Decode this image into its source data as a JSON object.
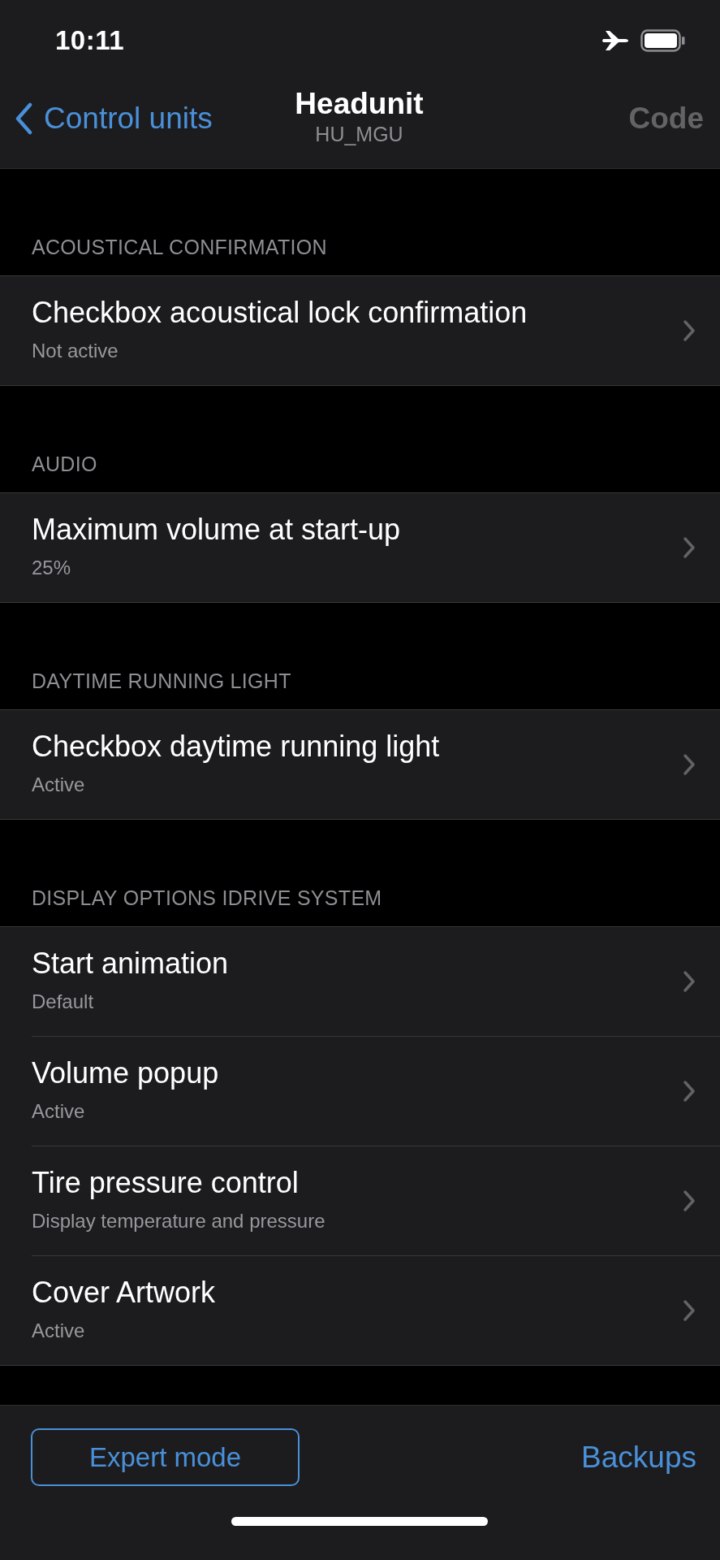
{
  "status_bar": {
    "time": "10:11"
  },
  "nav": {
    "back_label": "Control units",
    "title": "Headunit",
    "subtitle": "HU_MGU",
    "right_button": {
      "label": "Code",
      "disabled": true
    }
  },
  "sections": [
    {
      "header": "ACOUSTICAL CONFIRMATION",
      "items": [
        {
          "title": "Checkbox acoustical lock confirmation",
          "value": "Not active"
        }
      ]
    },
    {
      "header": "AUDIO",
      "items": [
        {
          "title": "Maximum volume at start-up",
          "value": "25%"
        }
      ]
    },
    {
      "header": "DAYTIME RUNNING LIGHT",
      "items": [
        {
          "title": "Checkbox daytime running light",
          "value": "Active"
        }
      ]
    },
    {
      "header": "DISPLAY OPTIONS IDRIVE SYSTEM",
      "items": [
        {
          "title": "Start animation",
          "value": "Default"
        },
        {
          "title": "Volume popup",
          "value": "Active"
        },
        {
          "title": "Tire pressure control",
          "value": "Display temperature and pressure"
        },
        {
          "title": "Cover Artwork",
          "value": "Active"
        }
      ]
    }
  ],
  "bottom_bar": {
    "left_button": "Expert mode",
    "right_button": "Backups"
  }
}
